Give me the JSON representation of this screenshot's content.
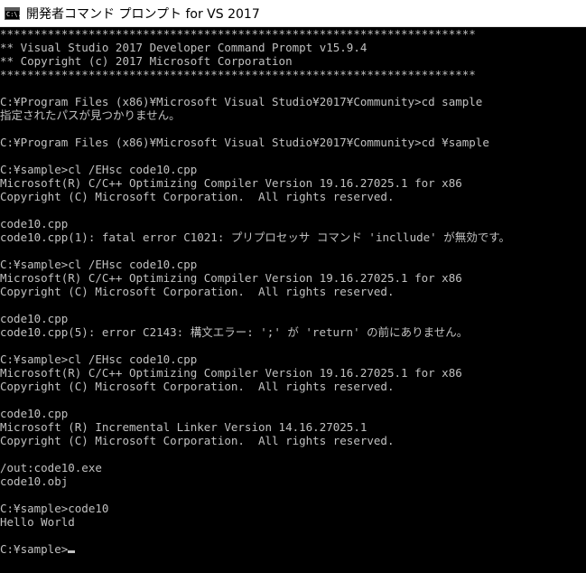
{
  "window": {
    "title": "開発者コマンド プロンプト for VS 2017",
    "icon": "cmd-icon",
    "icon_glyph": "C:\\."
  },
  "console": {
    "lines": [
      "**********************************************************************",
      "** Visual Studio 2017 Developer Command Prompt v15.9.4",
      "** Copyright (c) 2017 Microsoft Corporation",
      "**********************************************************************",
      "",
      "C:¥Program Files (x86)¥Microsoft Visual Studio¥2017¥Community>cd sample",
      "指定されたパスが見つかりません。",
      "",
      "C:¥Program Files (x86)¥Microsoft Visual Studio¥2017¥Community>cd ¥sample",
      "",
      "C:¥sample>cl /EHsc code10.cpp",
      "Microsoft(R) C/C++ Optimizing Compiler Version 19.16.27025.1 for x86",
      "Copyright (C) Microsoft Corporation.  All rights reserved.",
      "",
      "code10.cpp",
      "code10.cpp(1): fatal error C1021: プリプロセッサ コマンド 'incllude' が無効です。",
      "",
      "C:¥sample>cl /EHsc code10.cpp",
      "Microsoft(R) C/C++ Optimizing Compiler Version 19.16.27025.1 for x86",
      "Copyright (C) Microsoft Corporation.  All rights reserved.",
      "",
      "code10.cpp",
      "code10.cpp(5): error C2143: 構文エラー: ';' が 'return' の前にありません。",
      "",
      "C:¥sample>cl /EHsc code10.cpp",
      "Microsoft(R) C/C++ Optimizing Compiler Version 19.16.27025.1 for x86",
      "Copyright (C) Microsoft Corporation.  All rights reserved.",
      "",
      "code10.cpp",
      "Microsoft (R) Incremental Linker Version 14.16.27025.1",
      "Copyright (C) Microsoft Corporation.  All rights reserved.",
      "",
      "/out:code10.exe",
      "code10.obj",
      "",
      "C:¥sample>code10",
      "Hello World",
      "",
      "C:¥sample>"
    ]
  },
  "colors": {
    "console_background": "#000000",
    "console_text": "#c0c0c0",
    "titlebar_background": "#ffffff",
    "titlebar_text": "#000000"
  }
}
